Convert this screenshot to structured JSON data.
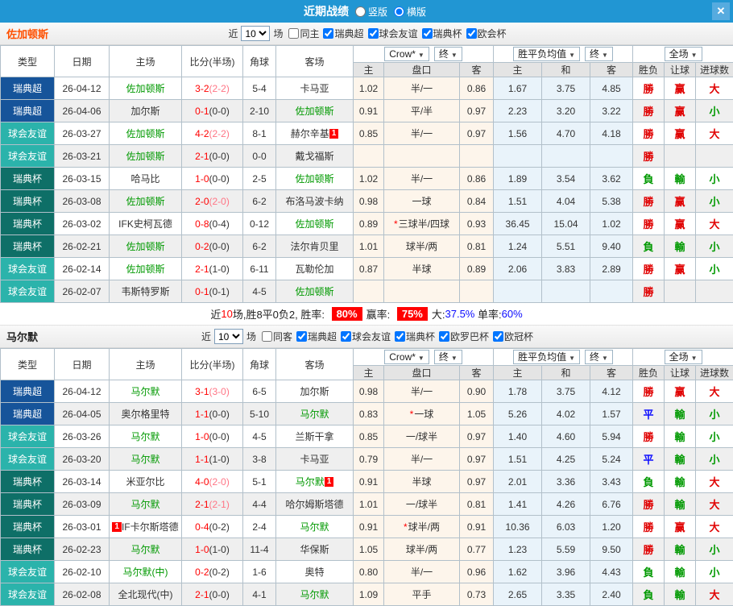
{
  "titlebar": {
    "title": "近期战绩",
    "layout_options": [
      {
        "label": "竖版",
        "selected": false
      },
      {
        "label": "横版",
        "selected": true
      }
    ],
    "close_label": "✕"
  },
  "colors": {
    "league": {
      "瑞典超": "#16549a",
      "球会友谊": "#2bb3ab",
      "瑞典杯": "#0e6f67"
    },
    "result": {
      "r": "#e00000",
      "g": "#009900",
      "b": "#0b0bff"
    },
    "team_green": "#009900",
    "score_red": "#ff0000",
    "half_pink": "#ff7585",
    "accent_blue": "#2196d3"
  },
  "table_head": {
    "left": [
      "类型",
      "日期",
      "主场",
      "比分(半场)",
      "角球",
      "客场"
    ],
    "sub": [
      "主",
      "盘口",
      "客",
      "主",
      "和",
      "客",
      "胜负",
      "让球",
      "进球数"
    ],
    "groups": [
      [
        "Crow*",
        "终"
      ],
      [
        "胜平负均值",
        "终"
      ],
      [
        "全场"
      ]
    ]
  },
  "sections": [
    {
      "team": "佐加顿斯",
      "team_color": "#ff5000",
      "near_label": "近",
      "near_value": "10",
      "chang_label": "场",
      "filters": [
        {
          "label": "同主",
          "checked": false
        },
        {
          "label": "瑞典超",
          "checked": true
        },
        {
          "label": "球会友谊",
          "checked": true
        },
        {
          "label": "瑞典杯",
          "checked": true
        },
        {
          "label": "欧会杯",
          "checked": true
        }
      ],
      "rows": [
        {
          "league": "瑞典超",
          "date": "26-04-12",
          "home": "佐加顿斯",
          "home_green": true,
          "home_badge": false,
          "ft": "3-2",
          "ht": "(2-2)",
          "ht_red": true,
          "corner": "5-4",
          "away": "卡马亚",
          "away_green": false,
          "away_badge": false,
          "o_home": "1.02",
          "hcap": "半/一",
          "hcap_star": false,
          "o_away": "0.86",
          "avg_home": "1.67",
          "avg_draw": "3.75",
          "avg_away": "4.85",
          "results": [
            [
              "勝",
              "r"
            ],
            [
              "赢",
              "r"
            ],
            [
              "大",
              "r"
            ]
          ]
        },
        {
          "league": "瑞典超",
          "date": "26-04-06",
          "home": "加尔斯",
          "home_green": false,
          "home_badge": false,
          "ft": "0-1",
          "ht": "(0-0)",
          "ht_red": false,
          "corner": "2-10",
          "away": "佐加顿斯",
          "away_green": true,
          "away_badge": false,
          "o_home": "0.91",
          "hcap": "平/半",
          "hcap_star": false,
          "o_away": "0.97",
          "avg_home": "2.23",
          "avg_draw": "3.20",
          "avg_away": "3.22",
          "results": [
            [
              "勝",
              "r"
            ],
            [
              "赢",
              "r"
            ],
            [
              "小",
              "g"
            ]
          ]
        },
        {
          "league": "球会友谊",
          "date": "26-03-27",
          "home": "佐加顿斯",
          "home_green": true,
          "home_badge": false,
          "ft": "4-2",
          "ht": "(2-2)",
          "ht_red": true,
          "corner": "8-1",
          "away": "赫尔辛基",
          "away_green": false,
          "away_badge": true,
          "o_home": "0.85",
          "hcap": "半/一",
          "hcap_star": false,
          "o_away": "0.97",
          "avg_home": "1.56",
          "avg_draw": "4.70",
          "avg_away": "4.18",
          "results": [
            [
              "勝",
              "r"
            ],
            [
              "赢",
              "r"
            ],
            [
              "大",
              "r"
            ]
          ]
        },
        {
          "league": "球会友谊",
          "date": "26-03-21",
          "home": "佐加顿斯",
          "home_green": true,
          "home_badge": false,
          "ft": "2-1",
          "ht": "(0-0)",
          "ht_red": false,
          "corner": "0-0",
          "away": "戴戈福斯",
          "away_green": false,
          "away_badge": false,
          "o_home": "",
          "hcap": "",
          "hcap_star": false,
          "o_away": "",
          "avg_home": "",
          "avg_draw": "",
          "avg_away": "",
          "results": [
            [
              "勝",
              "r"
            ],
            [
              "",
              ""
            ],
            [
              "",
              ""
            ]
          ]
        },
        {
          "league": "瑞典杯",
          "date": "26-03-15",
          "home": "哈马比",
          "home_green": false,
          "home_badge": false,
          "ft": "1-0",
          "ht": "(0-0)",
          "ht_red": false,
          "corner": "2-5",
          "away": "佐加顿斯",
          "away_green": true,
          "away_badge": false,
          "o_home": "1.02",
          "hcap": "半/一",
          "hcap_star": false,
          "o_away": "0.86",
          "avg_home": "1.89",
          "avg_draw": "3.54",
          "avg_away": "3.62",
          "results": [
            [
              "負",
              "g"
            ],
            [
              "輸",
              "g"
            ],
            [
              "小",
              "g"
            ]
          ]
        },
        {
          "league": "瑞典杯",
          "date": "26-03-08",
          "home": "佐加顿斯",
          "home_green": true,
          "home_badge": false,
          "ft": "2-0",
          "ht": "(2-0)",
          "ht_red": true,
          "corner": "6-2",
          "away": "布洛马波卡纳",
          "away_green": false,
          "away_badge": false,
          "o_home": "0.98",
          "hcap": "一球",
          "hcap_star": false,
          "o_away": "0.84",
          "avg_home": "1.51",
          "avg_draw": "4.04",
          "avg_away": "5.38",
          "results": [
            [
              "勝",
              "r"
            ],
            [
              "赢",
              "r"
            ],
            [
              "小",
              "g"
            ]
          ]
        },
        {
          "league": "瑞典杯",
          "date": "26-03-02",
          "home": "IFK史柯瓦德",
          "home_green": false,
          "home_badge": false,
          "ft": "0-8",
          "ht": "(0-4)",
          "ht_red": false,
          "corner": "0-12",
          "away": "佐加顿斯",
          "away_green": true,
          "away_badge": false,
          "o_home": "0.89",
          "hcap": "三球半/四球",
          "hcap_star": true,
          "o_away": "0.93",
          "avg_home": "36.45",
          "avg_draw": "15.04",
          "avg_away": "1.02",
          "results": [
            [
              "勝",
              "r"
            ],
            [
              "赢",
              "r"
            ],
            [
              "大",
              "r"
            ]
          ]
        },
        {
          "league": "瑞典杯",
          "date": "26-02-21",
          "home": "佐加顿斯",
          "home_green": true,
          "home_badge": false,
          "ft": "0-2",
          "ht": "(0-0)",
          "ht_red": false,
          "corner": "6-2",
          "away": "法尔肯贝里",
          "away_green": false,
          "away_badge": false,
          "o_home": "1.01",
          "hcap": "球半/两",
          "hcap_star": false,
          "o_away": "0.81",
          "avg_home": "1.24",
          "avg_draw": "5.51",
          "avg_away": "9.40",
          "results": [
            [
              "負",
              "g"
            ],
            [
              "輸",
              "g"
            ],
            [
              "小",
              "g"
            ]
          ]
        },
        {
          "league": "球会友谊",
          "date": "26-02-14",
          "home": "佐加顿斯",
          "home_green": true,
          "home_badge": false,
          "ft": "2-1",
          "ht": "(1-0)",
          "ht_red": false,
          "corner": "6-11",
          "away": "瓦勒伦加",
          "away_green": false,
          "away_badge": false,
          "o_home": "0.87",
          "hcap": "半球",
          "hcap_star": false,
          "o_away": "0.89",
          "avg_home": "2.06",
          "avg_draw": "3.83",
          "avg_away": "2.89",
          "results": [
            [
              "勝",
              "r"
            ],
            [
              "赢",
              "r"
            ],
            [
              "小",
              "g"
            ]
          ]
        },
        {
          "league": "球会友谊",
          "date": "26-02-07",
          "home": "韦斯特罗斯",
          "home_green": false,
          "home_badge": false,
          "ft": "0-1",
          "ht": "(0-1)",
          "ht_red": false,
          "corner": "4-5",
          "away": "佐加顿斯",
          "away_green": true,
          "away_badge": false,
          "o_home": "",
          "hcap": "",
          "hcap_star": false,
          "o_away": "",
          "avg_home": "",
          "avg_draw": "",
          "avg_away": "",
          "results": [
            [
              "勝",
              "r"
            ],
            [
              "",
              ""
            ],
            [
              "",
              ""
            ]
          ]
        }
      ],
      "summary": [
        [
          "近",
          "k"
        ],
        [
          "10",
          "r"
        ],
        [
          "场,胜8平0负2, 胜率: ",
          "k"
        ],
        [
          "80%",
          "badge"
        ],
        [
          "赢率: ",
          "k"
        ],
        [
          "75%",
          "badge"
        ],
        [
          "大:",
          "k"
        ],
        [
          "37.5%",
          "b"
        ],
        [
          " 单率:",
          "k"
        ],
        [
          "60%",
          "b"
        ]
      ]
    },
    {
      "team": "马尔默",
      "team_color": "#222222",
      "near_label": "近",
      "near_value": "10",
      "chang_label": "场",
      "filters": [
        {
          "label": "同客",
          "checked": false
        },
        {
          "label": "瑞典超",
          "checked": true
        },
        {
          "label": "球会友谊",
          "checked": true
        },
        {
          "label": "瑞典杯",
          "checked": true
        },
        {
          "label": "欧罗巴杯",
          "checked": true
        },
        {
          "label": "欧冠杯",
          "checked": true
        }
      ],
      "rows": [
        {
          "league": "瑞典超",
          "date": "26-04-12",
          "home": "马尔默",
          "home_green": true,
          "home_badge": false,
          "ft": "3-1",
          "ht": "(3-0)",
          "ht_red": true,
          "corner": "6-5",
          "away": "加尔斯",
          "away_green": false,
          "away_badge": false,
          "o_home": "0.98",
          "hcap": "半/一",
          "hcap_star": false,
          "o_away": "0.90",
          "avg_home": "1.78",
          "avg_draw": "3.75",
          "avg_away": "4.12",
          "results": [
            [
              "勝",
              "r"
            ],
            [
              "赢",
              "r"
            ],
            [
              "大",
              "r"
            ]
          ]
        },
        {
          "league": "瑞典超",
          "date": "26-04-05",
          "home": "奥尔格里特",
          "home_green": false,
          "home_badge": false,
          "ft": "1-1",
          "ht": "(0-0)",
          "ht_red": false,
          "corner": "5-10",
          "away": "马尔默",
          "away_green": true,
          "away_badge": false,
          "o_home": "0.83",
          "hcap": "一球",
          "hcap_star": true,
          "o_away": "1.05",
          "avg_home": "5.26",
          "avg_draw": "4.02",
          "avg_away": "1.57",
          "results": [
            [
              "平",
              "b"
            ],
            [
              "輸",
              "g"
            ],
            [
              "小",
              "g"
            ]
          ]
        },
        {
          "league": "球会友谊",
          "date": "26-03-26",
          "home": "马尔默",
          "home_green": true,
          "home_badge": false,
          "ft": "1-0",
          "ht": "(0-0)",
          "ht_red": false,
          "corner": "4-5",
          "away": "兰斯干拿",
          "away_green": false,
          "away_badge": false,
          "o_home": "0.85",
          "hcap": "一/球半",
          "hcap_star": false,
          "o_away": "0.97",
          "avg_home": "1.40",
          "avg_draw": "4.60",
          "avg_away": "5.94",
          "results": [
            [
              "勝",
              "r"
            ],
            [
              "輸",
              "g"
            ],
            [
              "小",
              "g"
            ]
          ]
        },
        {
          "league": "球会友谊",
          "date": "26-03-20",
          "home": "马尔默",
          "home_green": true,
          "home_badge": false,
          "ft": "1-1",
          "ht": "(1-0)",
          "ht_red": false,
          "corner": "3-8",
          "away": "卡马亚",
          "away_green": false,
          "away_badge": false,
          "o_home": "0.79",
          "hcap": "半/一",
          "hcap_star": false,
          "o_away": "0.97",
          "avg_home": "1.51",
          "avg_draw": "4.25",
          "avg_away": "5.24",
          "results": [
            [
              "平",
              "b"
            ],
            [
              "輸",
              "g"
            ],
            [
              "小",
              "g"
            ]
          ]
        },
        {
          "league": "瑞典杯",
          "date": "26-03-14",
          "home": "米亚尔比",
          "home_green": false,
          "home_badge": false,
          "ft": "4-0",
          "ht": "(2-0)",
          "ht_red": true,
          "corner": "5-1",
          "away": "马尔默",
          "away_green": true,
          "away_badge": true,
          "o_home": "0.91",
          "hcap": "半球",
          "hcap_star": false,
          "o_away": "0.97",
          "avg_home": "2.01",
          "avg_draw": "3.36",
          "avg_away": "3.43",
          "results": [
            [
              "負",
              "g"
            ],
            [
              "輸",
              "g"
            ],
            [
              "大",
              "r"
            ]
          ]
        },
        {
          "league": "瑞典杯",
          "date": "26-03-09",
          "home": "马尔默",
          "home_green": true,
          "home_badge": false,
          "ft": "2-1",
          "ht": "(2-1)",
          "ht_red": true,
          "corner": "4-4",
          "away": "哈尔姆斯塔德",
          "away_green": false,
          "away_badge": false,
          "o_home": "1.01",
          "hcap": "一/球半",
          "hcap_star": false,
          "o_away": "0.81",
          "avg_home": "1.41",
          "avg_draw": "4.26",
          "avg_away": "6.76",
          "results": [
            [
              "勝",
              "r"
            ],
            [
              "輸",
              "g"
            ],
            [
              "大",
              "r"
            ]
          ]
        },
        {
          "league": "瑞典杯",
          "date": "26-03-01",
          "home": "IF卡尔斯塔德",
          "home_green": false,
          "home_badge": true,
          "ft": "0-4",
          "ht": "(0-2)",
          "ht_red": false,
          "corner": "2-4",
          "away": "马尔默",
          "away_green": true,
          "away_badge": false,
          "o_home": "0.91",
          "hcap": "球半/两",
          "hcap_star": true,
          "o_away": "0.91",
          "avg_home": "10.36",
          "avg_draw": "6.03",
          "avg_away": "1.20",
          "results": [
            [
              "勝",
              "r"
            ],
            [
              "赢",
              "r"
            ],
            [
              "大",
              "r"
            ]
          ]
        },
        {
          "league": "瑞典杯",
          "date": "26-02-23",
          "home": "马尔默",
          "home_green": true,
          "home_badge": false,
          "ft": "1-0",
          "ht": "(1-0)",
          "ht_red": false,
          "corner": "11-4",
          "away": "华保斯",
          "away_green": false,
          "away_badge": false,
          "o_home": "1.05",
          "hcap": "球半/两",
          "hcap_star": false,
          "o_away": "0.77",
          "avg_home": "1.23",
          "avg_draw": "5.59",
          "avg_away": "9.50",
          "results": [
            [
              "勝",
              "r"
            ],
            [
              "輸",
              "g"
            ],
            [
              "小",
              "g"
            ]
          ]
        },
        {
          "league": "球会友谊",
          "date": "26-02-10",
          "home": "马尔默(中)",
          "home_green": true,
          "home_badge": false,
          "ft": "0-2",
          "ht": "(0-2)",
          "ht_red": false,
          "corner": "1-6",
          "away": "奥特",
          "away_green": false,
          "away_badge": false,
          "o_home": "0.80",
          "hcap": "半/一",
          "hcap_star": false,
          "o_away": "0.96",
          "avg_home": "1.62",
          "avg_draw": "3.96",
          "avg_away": "4.43",
          "results": [
            [
              "負",
              "g"
            ],
            [
              "輸",
              "g"
            ],
            [
              "小",
              "g"
            ]
          ]
        },
        {
          "league": "球会友谊",
          "date": "26-02-08",
          "home": "全北现代(中)",
          "home_green": false,
          "home_badge": false,
          "ft": "2-1",
          "ht": "(0-0)",
          "ht_red": false,
          "corner": "4-1",
          "away": "马尔默",
          "away_green": true,
          "away_badge": false,
          "o_home": "1.09",
          "hcap": "平手",
          "hcap_star": false,
          "o_away": "0.73",
          "avg_home": "2.65",
          "avg_draw": "3.35",
          "avg_away": "2.40",
          "results": [
            [
              "負",
              "g"
            ],
            [
              "輸",
              "g"
            ],
            [
              "大",
              "r"
            ]
          ]
        }
      ],
      "summary": null
    }
  ]
}
